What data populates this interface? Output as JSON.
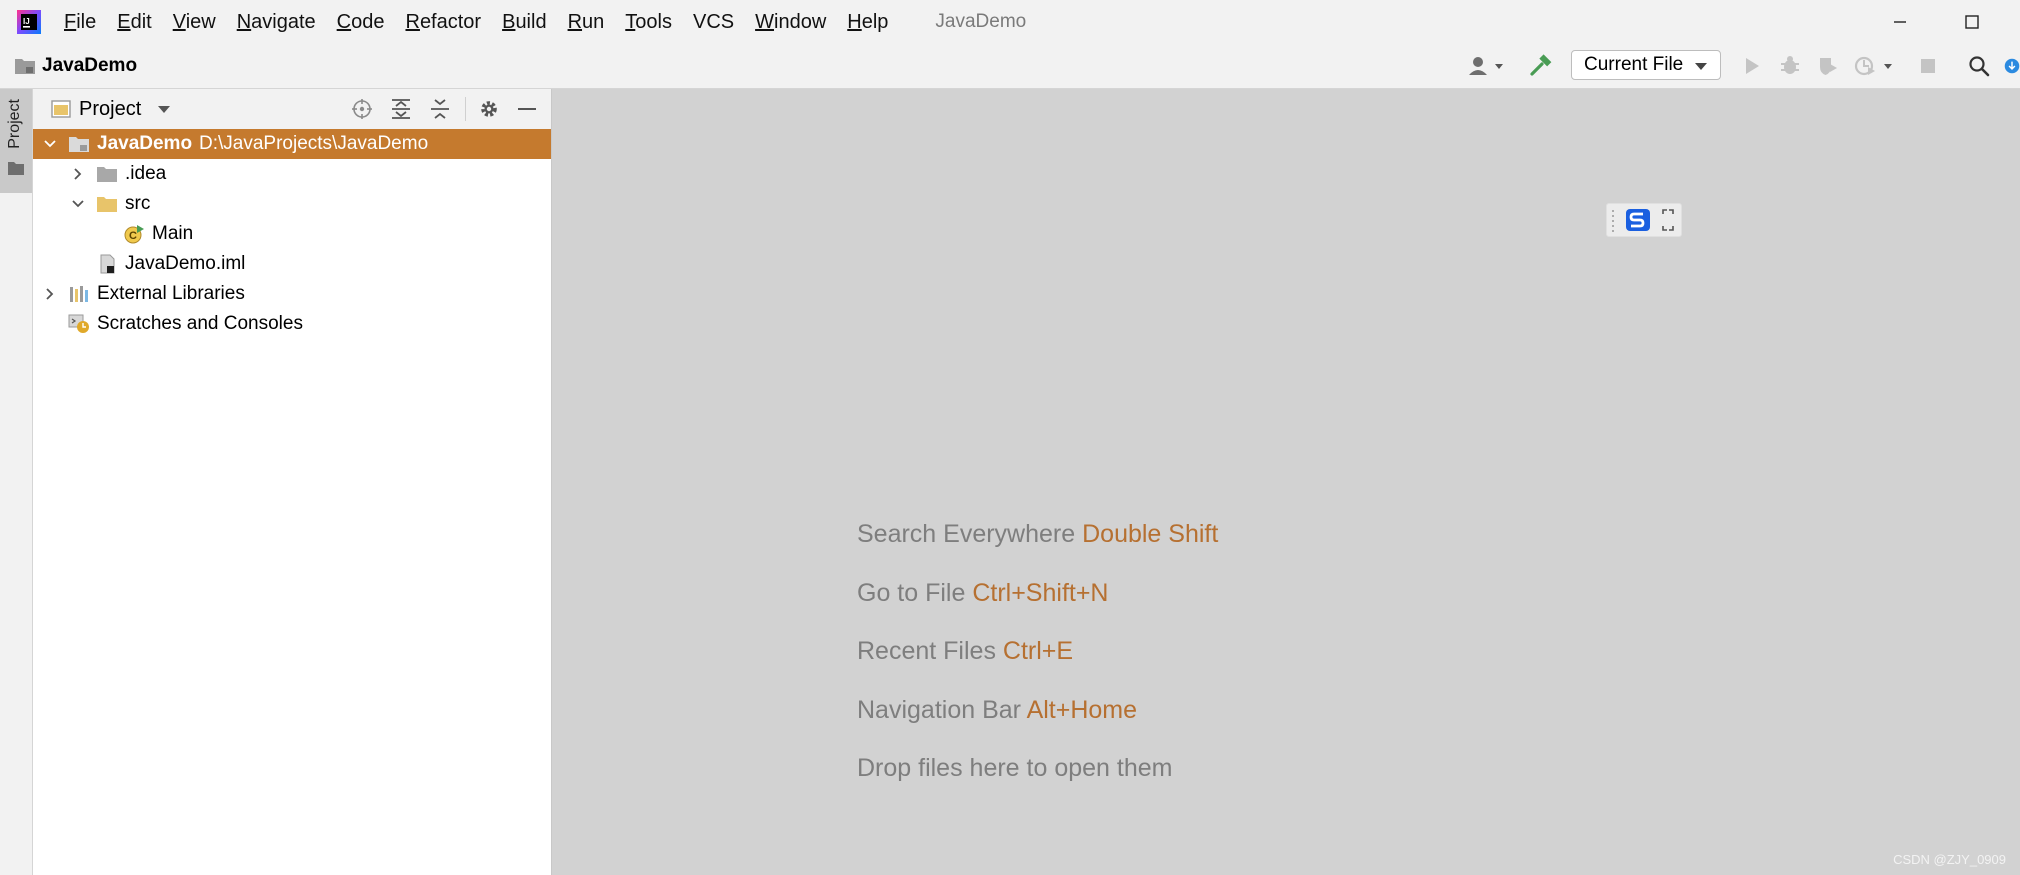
{
  "menubar": {
    "items": [
      {
        "mnemonic": "F",
        "rest": "ile"
      },
      {
        "mnemonic": "E",
        "rest": "dit"
      },
      {
        "mnemonic": "V",
        "rest": "iew"
      },
      {
        "mnemonic": "N",
        "rest": "avigate"
      },
      {
        "mnemonic": "C",
        "rest": "ode"
      },
      {
        "mnemonic": "R",
        "rest": "efactor"
      },
      {
        "mnemonic": "B",
        "rest": "uild"
      },
      {
        "mnemonic": "R",
        "rest": "un"
      },
      {
        "mnemonic": "T",
        "rest": "ools"
      },
      {
        "mnemonic": "",
        "rest": "VCS"
      },
      {
        "mnemonic": "W",
        "rest": "indow"
      },
      {
        "mnemonic": "H",
        "rest": "elp"
      }
    ],
    "window_title": "JavaDemo"
  },
  "navbar": {
    "project_name": "JavaDemo",
    "run_config": "Current File"
  },
  "left_stripe": {
    "tab_label": "Project"
  },
  "project_panel": {
    "title": "Project",
    "tree": [
      {
        "label": "JavaDemo",
        "path": "D:\\JavaProjects\\JavaDemo"
      },
      {
        "label": ".idea"
      },
      {
        "label": "src"
      },
      {
        "label": "Main"
      },
      {
        "label": "JavaDemo.iml"
      },
      {
        "label": "External Libraries"
      },
      {
        "label": "Scratches and Consoles"
      }
    ]
  },
  "editor": {
    "hints": [
      {
        "text": "Search Everywhere",
        "key": "Double Shift"
      },
      {
        "text": "Go to File",
        "key": "Ctrl+Shift+N"
      },
      {
        "text": "Recent Files",
        "key": "Ctrl+E"
      },
      {
        "text": "Navigation Bar",
        "key": "Alt+Home"
      },
      {
        "text": "Drop files here to open them",
        "key": ""
      }
    ]
  },
  "watermark": "CSDN @ZJY_0909",
  "colors": {
    "selection": "#c57a2e",
    "shortcut": "#b67031",
    "editor_bg": "#d2d2d2"
  }
}
